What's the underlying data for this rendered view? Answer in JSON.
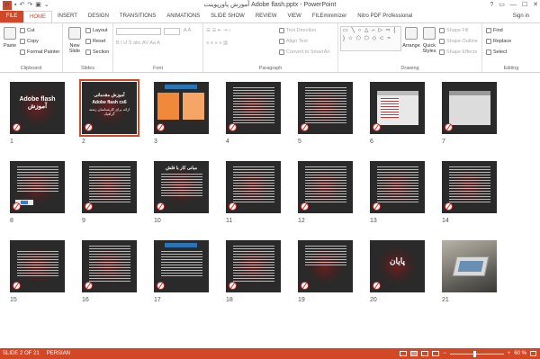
{
  "title_bar": {
    "logo": "P",
    "qat_icons": [
      "save-icon",
      "undo-icon",
      "redo-icon",
      "start-slideshow-icon",
      "customize-icon"
    ],
    "document_title": "آموزش پاورپوینت Adobe flash.pptx - PowerPoint",
    "window_controls": [
      "?",
      "▭",
      "—",
      "☐",
      "✕"
    ]
  },
  "tabs": {
    "file": "FILE",
    "items": [
      "HOME",
      "INSERT",
      "DESIGN",
      "TRANSITIONS",
      "ANIMATIONS",
      "SLIDE SHOW",
      "REVIEW",
      "VIEW",
      "FILEminimizer",
      "Nitro PDF Professional"
    ],
    "active": "HOME",
    "sign_in": "Sign in"
  },
  "ribbon": {
    "clipboard": {
      "label": "Clipboard",
      "paste": "Paste",
      "cut": "Cut",
      "copy": "Copy",
      "format_painter": "Format Painter"
    },
    "slides": {
      "label": "Slides",
      "new_slide": "New Slide",
      "layout": "Layout",
      "reset": "Reset",
      "section": "Section"
    },
    "font": {
      "label": "Font",
      "buttons": "B  I  U  S  abc  AV  Aa  A"
    },
    "paragraph": {
      "label": "Paragraph",
      "text_direction": "Text Direction",
      "align_text": "Align Text",
      "convert_smartart": "Convert to SmartArt"
    },
    "drawing": {
      "label": "Drawing",
      "shapes": "▭ ╲ ○ △ ⌐ ▷ ⇨ { } ☆ ⬠ ⬡ ◇ ⊂ ≈",
      "arrange": "Arrange",
      "quick_styles": "Quick Styles",
      "shape_fill": "Shape Fill",
      "shape_outline": "Shape Outline",
      "shape_effects": "Shape Effects"
    },
    "editing": {
      "label": "Editing",
      "find": "Find",
      "replace": "Replace",
      "select": "Select"
    }
  },
  "slides": [
    {
      "num": "1",
      "title": "Adobe flash  آموزش"
    },
    {
      "num": "2",
      "title": "آموزش مقدماتی",
      "subtitle": "Adobe flash cs6",
      "caption": "ارائه برای کارشناسان رشته گرافیک",
      "selected": true
    },
    {
      "num": "3"
    },
    {
      "num": "4"
    },
    {
      "num": "5"
    },
    {
      "num": "6"
    },
    {
      "num": "7"
    },
    {
      "num": "8"
    },
    {
      "num": "9"
    },
    {
      "num": "10",
      "title": "مبانی کار با فلش"
    },
    {
      "num": "11"
    },
    {
      "num": "12"
    },
    {
      "num": "13"
    },
    {
      "num": "14"
    },
    {
      "num": "15"
    },
    {
      "num": "16"
    },
    {
      "num": "17"
    },
    {
      "num": "18"
    },
    {
      "num": "19"
    },
    {
      "num": "20",
      "title": "پایان"
    },
    {
      "num": "21"
    }
  ],
  "status_bar": {
    "slide_indicator": "SLIDE 2 OF 21",
    "language": "PERSIAN",
    "zoom": "60 %",
    "minus": "−",
    "plus": "+"
  },
  "colors": {
    "accent": "#d24726",
    "slide_bg": "#2a2a2a"
  }
}
